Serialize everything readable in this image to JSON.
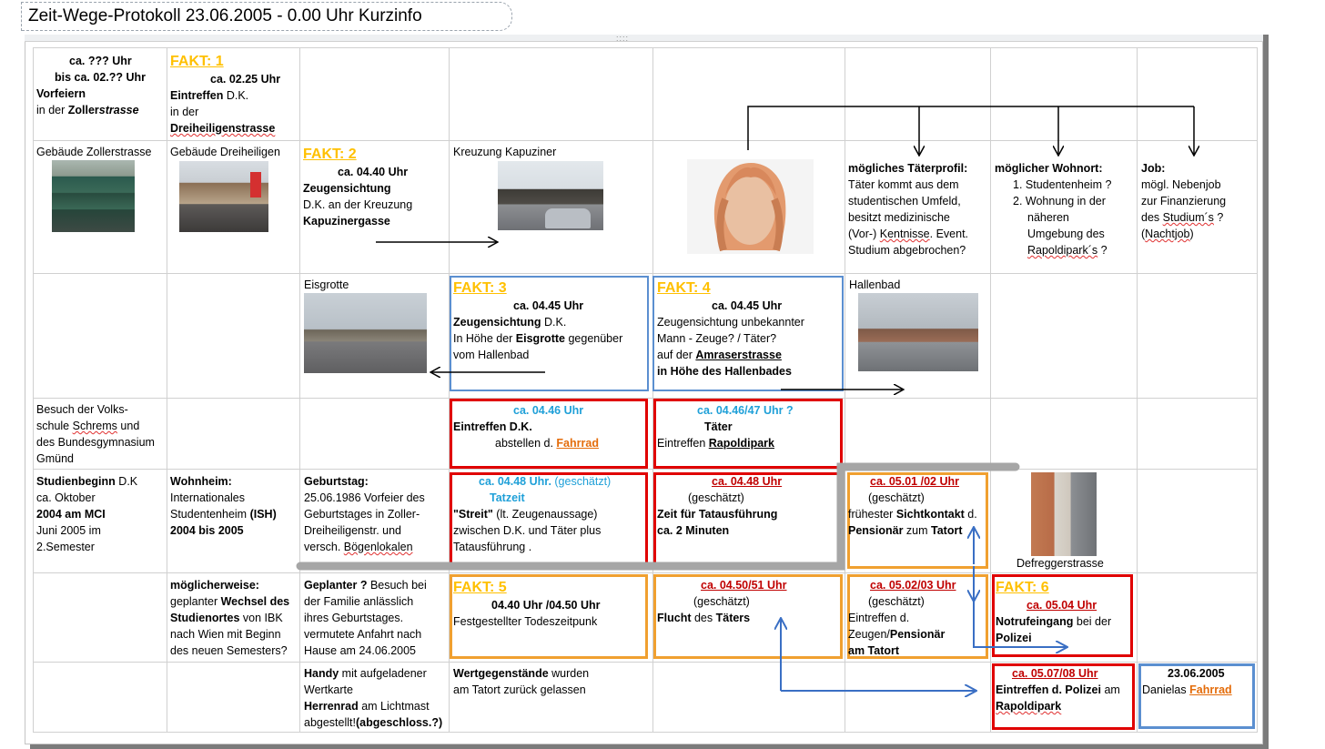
{
  "title": "Zeit-Wege-Protokoll 23.06.2005  - 0.00 Uhr Kurzinfo",
  "colors": {
    "fact": "#ffc000",
    "time_blue": "#1fa0d8",
    "time_red": "#c00000",
    "box_blue": "#5b8fd0",
    "box_red": "#e00000",
    "box_orange": "#f0a030",
    "connector_gray": "#a6a6a6",
    "arrow_blue": "#3a6fc4",
    "link_orange": "#e46c0a"
  },
  "row1": {
    "c1": {
      "l1": "ca. ??? Uhr",
      "l2": "bis ca. 02.?? Uhr",
      "l3": "Vorfeiern",
      "l4a": "in der ",
      "l4b": "Zoller",
      "l4c": "strasse"
    },
    "c2": {
      "fact": "FAKT: 1",
      "time": "ca. 02.25  Uhr",
      "l2a": "Eintreffen",
      "l2b": " D.K.",
      "l3": " in der",
      "l4": "Dreiheiligenstrasse"
    }
  },
  "row2": {
    "c1": {
      "label": "Gebäude Zollerstrasse",
      "icon": "building-photo"
    },
    "c2": {
      "label": "Gebäude Dreiheiligen",
      "icon": "street-photo"
    },
    "c3": {
      "fact": "FAKT: 2",
      "time": "ca. 04.40 Uhr",
      "l2": "Zeugensichtung",
      "l3": "D.K. an der Kreuzung",
      "l4": "Kapuzinergasse"
    },
    "c4": {
      "label": "Kreuzung Kapuziner",
      "icon": "bridge-photo"
    },
    "c5": {
      "icon": "face-reconstruction"
    },
    "c6": {
      "head": "mögliches Täterprofil:",
      "l1": "Täter kommt aus dem",
      "l2": "studentischen Umfeld,",
      "l3": "besitzt medizinische",
      "l4a": "(Vor-) ",
      "l4b": "Kentnisse",
      "l4c": ".  Event.",
      "l5": "Studium abgebrochen?"
    },
    "c7": {
      "head": "möglicher Wohnort:",
      "i1": "1.  Studentenheim ?",
      "i2": "2.  Wohnung in der",
      "i2b": "näheren",
      "i2c": "Umgebung des",
      "i2d": "Rapoldipark´s",
      "i2e": " ?"
    },
    "c8": {
      "head": "Job:",
      "l1": "mögl. Nebenjob",
      "l2": "zur Finanzierung",
      "l3a": "des ",
      "l3b": "Studium´s",
      "l3c": " ?",
      "l4a": "(",
      "l4b": "Nachtjob",
      "l4c": ")"
    }
  },
  "row3": {
    "c3": {
      "label": "Eisgrotte",
      "icon": "road-photo"
    },
    "c4": {
      "fact": "FAKT: 3",
      "time": "ca. 04.45  Uhr",
      "l2a": "Zeugensichtung",
      "l2b": " D.K.",
      "l3a": "In Höhe der ",
      "l3b": "Eisgrotte",
      "l3c": " gegenüber",
      "l4": "vom Hallenbad"
    },
    "c5": {
      "fact": "FAKT: 4",
      "time": "ca. 04.45  Uhr",
      "l2": "Zeugensichtung unbekannter",
      "l3": "Mann - Zeuge? / Täter?",
      "l4a": "auf der ",
      "l4b": "Amraserstrasse",
      "l5": "in Höhe des Hallenbades"
    },
    "c6": {
      "label": "Hallenbad",
      "icon": "pool-photo"
    }
  },
  "row4": {
    "c1": {
      "l1": "Besuch der Volks-",
      "l2a": "schule ",
      "l2b": "Schrems",
      "l2c": " und",
      "l3": "des Bundesgymnasium",
      "l4": "Gmünd"
    },
    "c4": {
      "time": "ca. 04.46  Uhr",
      "l2": "Eintreffen D.K.",
      "l3a": "abstellen d. ",
      "l3b": "Fahrrad"
    },
    "c5": {
      "time": "ca. 04.46/47  Uhr ?",
      "l2": "Täter",
      "l3a": "Eintreffen ",
      "l3b": "Rapoldipark"
    }
  },
  "row5": {
    "c1": {
      "l1a": "Studienbeginn",
      "l1b": " D.K",
      "l2": "ca. Oktober",
      "l3": "2004 am MCI",
      "l4": "Juni 2005  im",
      "l5": "2.Semester"
    },
    "c2": {
      "l1": "Wohnheim:",
      "l2": "Internationales",
      "l3a": "Studentenheim ",
      "l3b": "(ISH)",
      "l4": "2004  bis 2005"
    },
    "c3": {
      "l1": "Geburtstag:",
      "l2": "25.06.1986  Vorfeier des",
      "l3": "Geburtstages in Zoller-",
      "l4": "Dreiheiligenstr. und",
      "l5a": "versch. ",
      "l5b": "Bögenlokalen"
    },
    "c4": {
      "time": "ca. 04.48  Uhr.",
      "est": "  (geschätzt)",
      "tatzeit": "Tatzeit",
      "l3a": "\"Streit\"",
      "l3b": " (lt. Zeugenaussage)",
      "l4": "zwischen D.K. und Täter plus",
      "l5": "Tatausführung ."
    },
    "c5": {
      "time": "ca. 04.48  Uhr",
      "est": "(geschätzt)",
      "l3": "Zeit für Tatausführung",
      "l4": "ca. 2 Minuten"
    },
    "c6": {
      "time": "ca. 05.01  /02 Uhr",
      "est": "(geschätzt)",
      "l3a": "frühester ",
      "l3b": "Sichtkontakt",
      "l3c": " d.",
      "l4a": "Pensionär",
      "l4b": " zum ",
      "l4c": "Tatort"
    },
    "c7": {
      "label": "Defreggerstrasse",
      "icon": "houses-photo"
    }
  },
  "row6": {
    "c2": {
      "l1": "möglicherweise:",
      "l2a": "geplanter ",
      "l2b": "Wechsel des",
      "l3a": "Studienortes",
      "l3b": " von IBK",
      "l4": "nach Wien mit Beginn",
      "l5": "des neuen Semesters?"
    },
    "c3": {
      "l1a": "Geplanter ?",
      "l1b": " Besuch bei",
      "l2": "der Familie anlässlich",
      "l3": "ihres Geburtstages.",
      "l4": "vermutete Anfahrt nach",
      "l5": "Hause am 24.06.2005"
    },
    "c4": {
      "fact": "FAKT: 5",
      "time": "04.40 Uhr /04.50  Uhr",
      "l3": "Festgestellter Todeszeitpunk"
    },
    "c5": {
      "time": "ca. 04.50/51  Uhr",
      "est": "(geschätzt)",
      "l3a": "Flucht",
      "l3b": " des ",
      "l3c": "Täters"
    },
    "c6": {
      "time": "ca. 05.02/03  Uhr",
      "est": "(geschätzt)",
      "l3": "Eintreffen d.",
      "l4a": "Zeugen/",
      "l4b": "Pensionär",
      "l5": "am Tatort"
    },
    "c7": {
      "fact": "FAKT: 6",
      "time": "ca. 05.04  Uhr",
      "l3a": "Notrufeingang",
      "l3b": " bei der",
      "l4": "Polizei"
    }
  },
  "row7": {
    "c3": {
      "l1a": "Handy",
      "l1b": " mit aufgeladener",
      "l2": "Wertkarte",
      "l3a": "Herrenrad",
      "l3b": " am Lichtmast",
      "l4a": "abgestellt!",
      "l4b": "(abgeschloss.?)"
    },
    "c4": {
      "l1a": "Wertgegenstände",
      "l1b": " wurden",
      "l2": "am Tatort zurück gelassen"
    },
    "c7": {
      "time": "ca.  05.07/08  Uhr",
      "l2a": "Eintreffen d. Polizei",
      "l2b": " am",
      "l3": "Rapoldipark"
    },
    "c8": {
      "l1": "23.06.2005",
      "l2a": "Danielas ",
      "l2b": "Fahrrad"
    }
  },
  "window": {
    "handle": "::::"
  }
}
